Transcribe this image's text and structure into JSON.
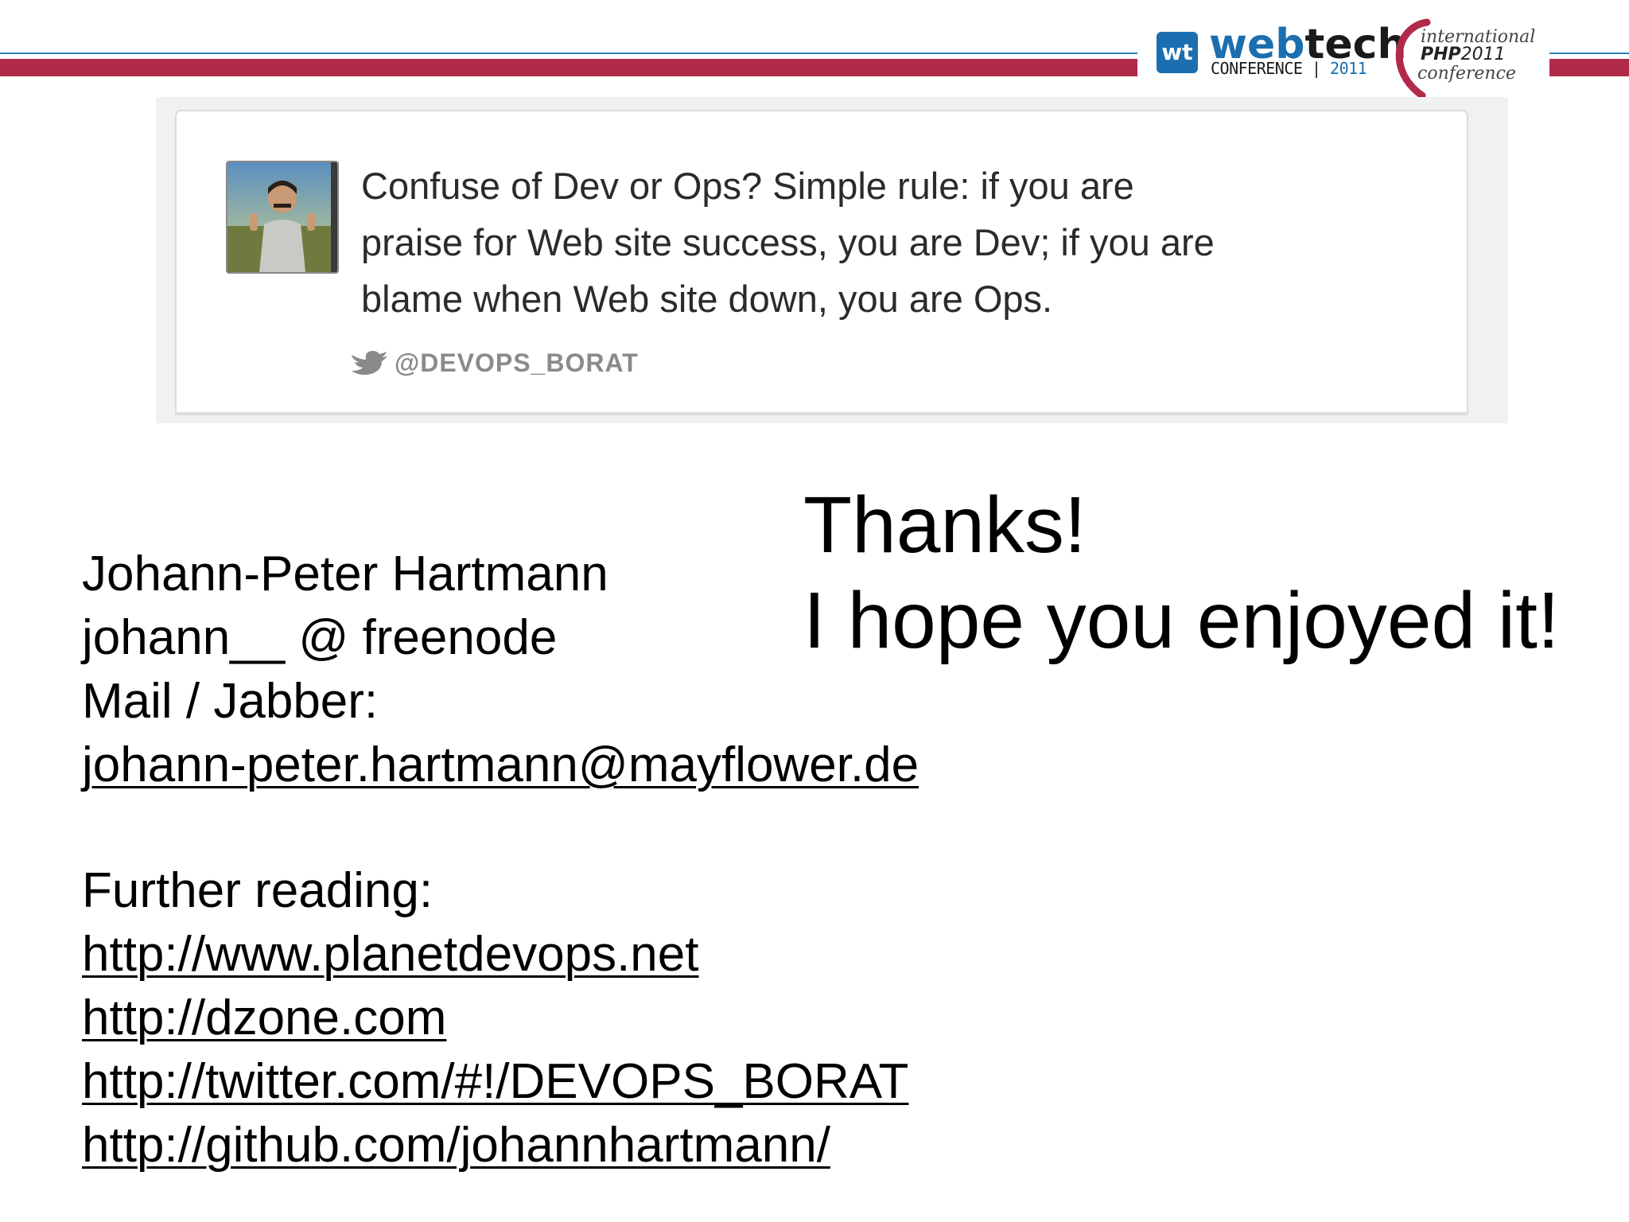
{
  "header": {
    "logo_webtech": {
      "badge": "wt",
      "word_web": "web",
      "word_tech": "tech",
      "sub": "CONFERENCE",
      "year": "2011"
    },
    "logo_php": {
      "line1": "international",
      "line2_bold": "PHP",
      "line2_year": "2011",
      "line3": "conference"
    },
    "colors": {
      "blue": "#2a7fb8",
      "red": "#b22a4a"
    }
  },
  "tweet": {
    "lines": [
      "Confuse of Dev or Ops? Simple rule: if you are",
      "praise for Web site success, you are Dev; if you are",
      "blame when Web site down, you are Ops."
    ],
    "handle": "@DEVOPS_BORAT",
    "icon": "twitter-bird-icon"
  },
  "thanks": {
    "line1": "Thanks!",
    "line2": "I hope you enjoyed it!"
  },
  "contact": {
    "name": "Johann-Peter Hartmann",
    "irc": "johann__ @ freenode",
    "mail_label": "Mail / Jabber:",
    "email": "johann-peter.hartmann@mayflower.de"
  },
  "further_reading": {
    "label": "Further reading:",
    "links": [
      "http://www.planetdevops.net",
      "http://dzone.com",
      "http://twitter.com/#!/DEVOPS_BORAT",
      "http://github.com/johannhartmann/"
    ]
  }
}
